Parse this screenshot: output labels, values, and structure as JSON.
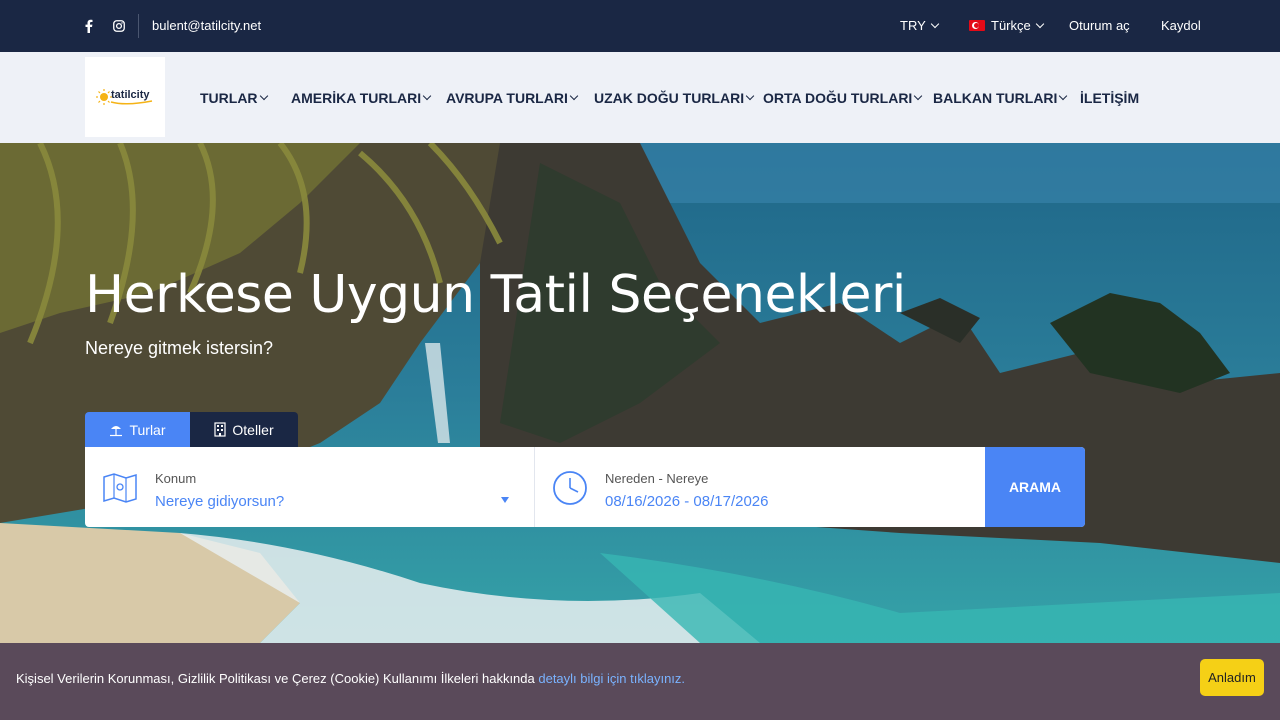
{
  "topbar": {
    "email": "bulent@tatilcity.net",
    "currency": "TRY",
    "language": "Türkçe",
    "login": "Oturum aç",
    "register": "Kaydol"
  },
  "logo": {
    "text": "tatilcity"
  },
  "nav": {
    "items": [
      "TURLAR",
      "AMERİKA TURLARI",
      "AVRUPA TURLARI",
      "UZAK DOĞU TURLARI",
      "ORTA DOĞU TURLARI",
      "BALKAN TURLARI",
      "İLETİŞİM"
    ]
  },
  "hero": {
    "title": "Herkese Uygun Tatil Seçenekleri",
    "subtitle": "Nereye gitmek istersin?"
  },
  "tabs": {
    "tours": "Turlar",
    "hotels": "Oteller"
  },
  "search": {
    "location_label": "Konum",
    "location_placeholder": "Nereye gidiyorsun?",
    "date_label": "Nereden - Nereye",
    "date_value": "08/16/2026 - 08/17/2026",
    "button": "ARAMA"
  },
  "cookie": {
    "text": "Kişisel Verilerin Korunması, Gizlilik Politikası ve Çerez (Cookie) Kullanımı İlkeleri hakkında ",
    "link": "detaylı bilgi için tıklayınız.",
    "accept": "Anladım"
  },
  "colors": {
    "topbar": "#1a2744",
    "accent": "#4a85f5",
    "cookie_bg": "#5a4a5a",
    "cookie_button": "#f5d016"
  }
}
